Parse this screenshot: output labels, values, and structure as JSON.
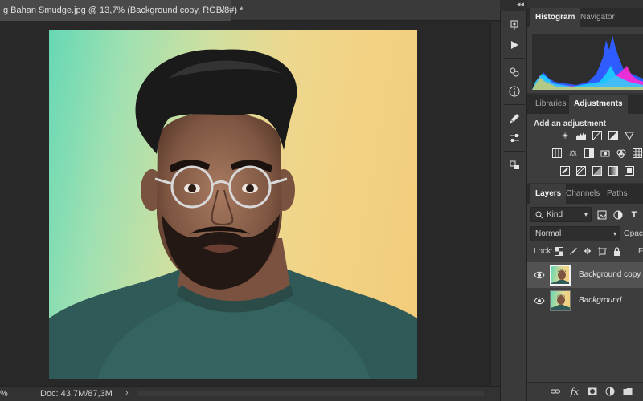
{
  "document": {
    "tab_title": "g Bahan Smudge.jpg @ 13,7% (Background copy, RGB/8#) *",
    "close_glyph": "×"
  },
  "status": {
    "zoom": "%",
    "doc_info": "Doc: 43,7M/87,3M",
    "arrow": "›"
  },
  "toolstrip": {
    "collapse_glyph": "◂◂",
    "icons": [
      "history-brush-icon",
      "play-icon",
      "properties-icon",
      "info-icon",
      "brush-settings-icon",
      "sliders-icon",
      "clone-source-icon"
    ]
  },
  "histogram_panel": {
    "tabs": [
      "Histogram",
      "Navigator"
    ],
    "active_tab": "Histogram"
  },
  "adjustments_panel": {
    "tabs": [
      "Libraries",
      "Adjustments"
    ],
    "active_tab": "Adjustments",
    "heading": "Add an adjustment"
  },
  "layers_panel": {
    "tabs": [
      "Layers",
      "Channels",
      "Paths"
    ],
    "active_tab": "Layers",
    "filter_label": "Kind",
    "blend_mode": "Normal",
    "opacity_label": "Opacit",
    "lock_label": "Lock:",
    "fill_label": "F",
    "layers": [
      {
        "name": "Background copy",
        "selected": true,
        "italic": false
      },
      {
        "name": "Background",
        "selected": false,
        "italic": true
      }
    ],
    "footer_fx": "fx"
  },
  "colors": {
    "ui_dark": "#282828",
    "panel": "#3d3d3d",
    "selected_layer": "#525252",
    "histo_blue": "#2f5cff",
    "histo_magenta": "#ff2ad4",
    "histo_cyan": "#19e0ff"
  }
}
